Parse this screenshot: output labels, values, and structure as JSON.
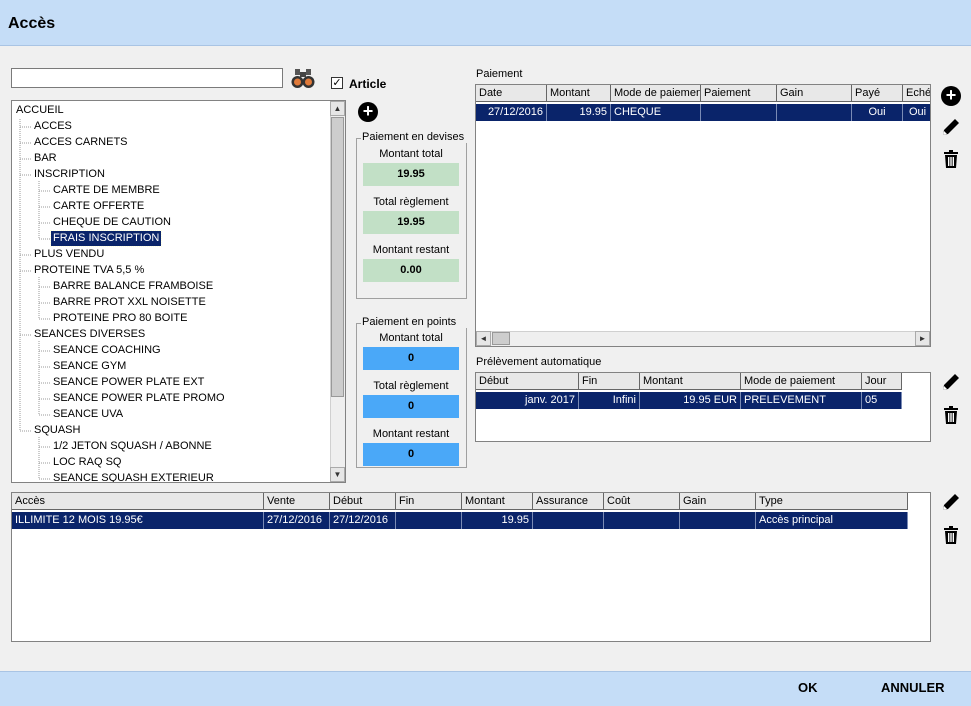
{
  "window": {
    "title": "Accès"
  },
  "search": {
    "value": ""
  },
  "article": {
    "label": "Article",
    "checked_glyph": "✓"
  },
  "tree": {
    "items": [
      {
        "label": "ACCUEIL",
        "level": 0
      },
      {
        "label": "ACCES",
        "level": 1
      },
      {
        "label": "ACCES CARNETS",
        "level": 1
      },
      {
        "label": "BAR",
        "level": 1
      },
      {
        "label": "INSCRIPTION",
        "level": 1
      },
      {
        "label": "CARTE DE MEMBRE",
        "level": 2
      },
      {
        "label": "CARTE OFFERTE",
        "level": 2
      },
      {
        "label": "CHEQUE DE CAUTION",
        "level": 2
      },
      {
        "label": "FRAIS INSCRIPTION",
        "level": 2,
        "selected": true
      },
      {
        "label": "PLUS VENDU",
        "level": 1
      },
      {
        "label": "PROTEINE TVA 5,5 %",
        "level": 1
      },
      {
        "label": "BARRE BALANCE FRAMBOISE",
        "level": 2
      },
      {
        "label": "BARRE PROT XXL NOISETTE",
        "level": 2
      },
      {
        "label": "PROTEINE PRO 80 BOITE",
        "level": 2
      },
      {
        "label": "SEANCES DIVERSES",
        "level": 1
      },
      {
        "label": "SEANCE COACHING",
        "level": 2
      },
      {
        "label": "SEANCE GYM",
        "level": 2
      },
      {
        "label": "SEANCE POWER PLATE EXT",
        "level": 2
      },
      {
        "label": "SEANCE POWER PLATE PROMO",
        "level": 2
      },
      {
        "label": "SEANCE UVA",
        "level": 2
      },
      {
        "label": "SQUASH",
        "level": 1
      },
      {
        "label": "1/2 JETON SQUASH / ABONNE",
        "level": 2
      },
      {
        "label": "LOC RAQ SQ",
        "level": 2
      },
      {
        "label": "SEANCE SQUASH EXTERIEUR",
        "level": 2
      }
    ]
  },
  "devises": {
    "legend": "Paiement en devises",
    "total_label": "Montant total",
    "total_value": "19.95",
    "reglement_label": "Total règlement",
    "reglement_value": "19.95",
    "restant_label": "Montant restant",
    "restant_value": "0.00"
  },
  "points": {
    "legend": "Paiement en points",
    "total_label": "Montant total",
    "total_value": "0",
    "reglement_label": "Total règlement",
    "reglement_value": "0",
    "restant_label": "Montant restant",
    "restant_value": "0"
  },
  "paiement": {
    "label": "Paiement",
    "columns": [
      "Date",
      "Montant",
      "Mode de paiement",
      "Paiement",
      "Gain",
      "Payé",
      "Echéance"
    ],
    "rows": [
      [
        "27/12/2016",
        "19.95",
        "CHEQUE",
        "",
        "",
        "Oui",
        "Oui"
      ]
    ]
  },
  "prelevement": {
    "label": "Prélèvement automatique",
    "columns": [
      "Début",
      "Fin",
      "Montant",
      "Mode de paiement",
      "Jour"
    ],
    "rows": [
      [
        "janv. 2017",
        "Infini",
        "19.95 EUR",
        "PRELEVEMENT",
        "05"
      ]
    ]
  },
  "acces": {
    "columns": [
      "Accès",
      "Vente",
      "Début",
      "Fin",
      "Montant",
      "Assurance",
      "Coût",
      "Gain",
      "Type"
    ],
    "rows": [
      [
        "ILLIMITE 12 MOIS 19.95€",
        "27/12/2016",
        "27/12/2016",
        "",
        "19.95",
        "",
        "",
        "",
        "Accès principal"
      ]
    ]
  },
  "footer": {
    "ok_label": "OK",
    "cancel_label": "ANNULER"
  },
  "icons": {
    "search": "binoculars-icon",
    "add": "plus-circle-icon",
    "edit": "pencil-icon",
    "delete": "trash-icon"
  },
  "colors": {
    "header": "#c5ddf7",
    "selection": "#0a246a",
    "green_box": "#c2e0c6",
    "blue_box": "#4aa8f8"
  }
}
